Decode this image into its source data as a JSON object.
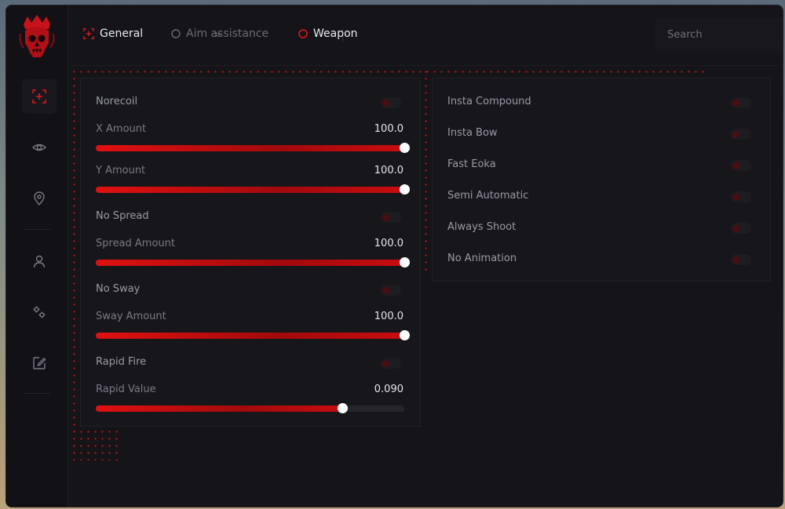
{
  "breadcrumb": {
    "general": "General",
    "separator": ">",
    "aim": "Aim assistance",
    "weapon": "Weapon"
  },
  "search": {
    "label": "Search",
    "collapse_glyph": "«"
  },
  "sidebar": {
    "icons": [
      "crosshair-icon",
      "eye-icon",
      "map-pin-icon",
      "user-icon",
      "settings-icon",
      "edit-icon"
    ],
    "active": "crosshair-icon"
  },
  "left_panel": {
    "norecoil": "Norecoil",
    "x_amount": {
      "label": "X Amount",
      "value": "100.0",
      "fill": 1.0
    },
    "y_amount": {
      "label": "Y Amount",
      "value": "100.0",
      "fill": 1.0
    },
    "no_spread": "No Spread",
    "spread_amount": {
      "label": "Spread Amount",
      "value": "100.0",
      "fill": 1.0
    },
    "no_sway": "No Sway",
    "sway_amount": {
      "label": "Sway Amount",
      "value": "100.0",
      "fill": 1.0
    },
    "rapid_fire": "Rapid Fire",
    "rapid_value": {
      "label": "Rapid Value",
      "value": "0.090",
      "fill": 0.8
    }
  },
  "right_panel": {
    "items": [
      "Insta Compound",
      "Insta Bow",
      "Fast Eoka",
      "Semi Automatic",
      "Always Shoot",
      "No Animation"
    ]
  },
  "colors": {
    "accent": "#d10f12",
    "background": "#141419",
    "panel": "#16161b"
  }
}
